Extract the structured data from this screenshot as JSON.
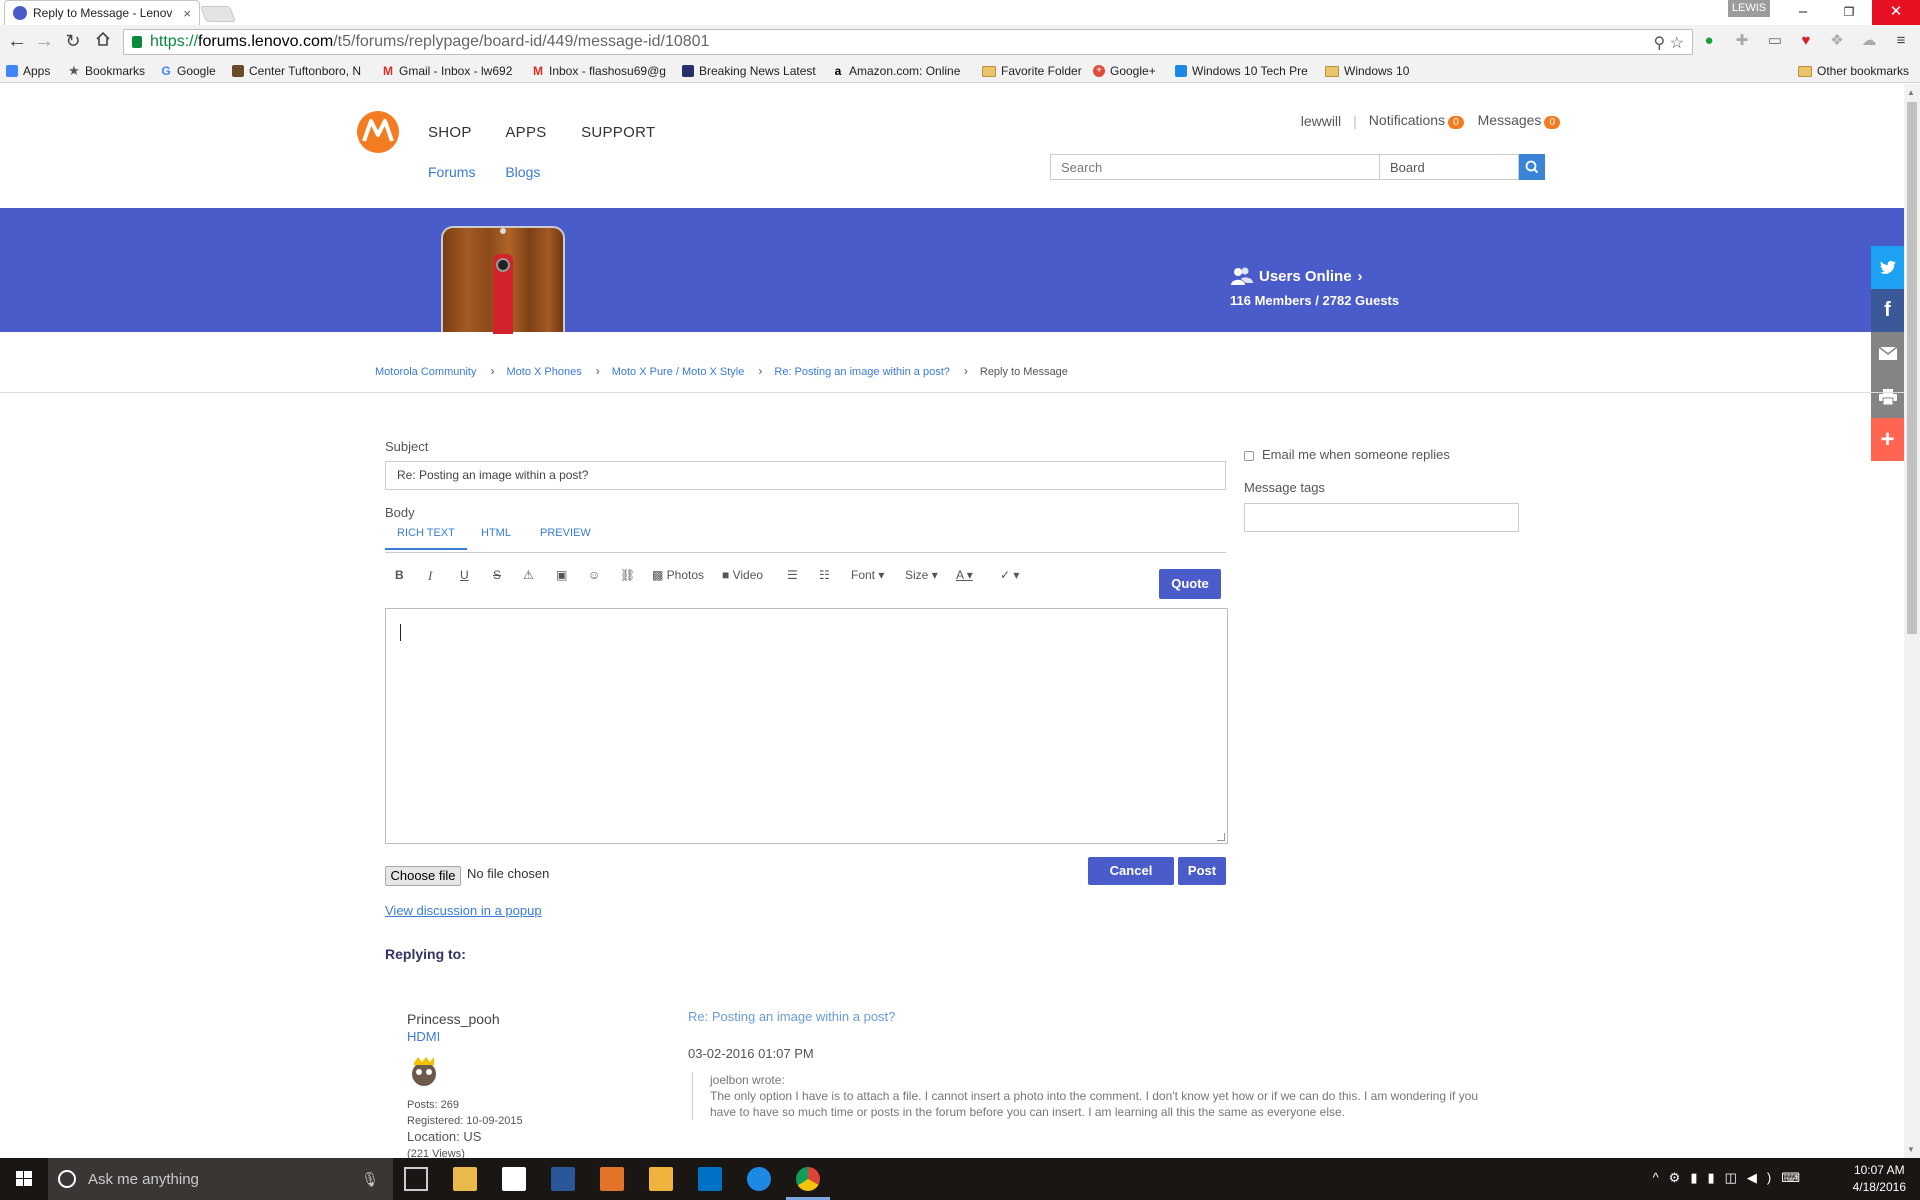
{
  "browser": {
    "tab_title": "Reply to Message - Lenov",
    "tab_close": "×",
    "profile": "LEWIS",
    "url_scheme": "https://",
    "url_host": "forums.lenovo.com",
    "url_path": "/t5/forums/replypage/board-id/449/message-id/10801",
    "window_controls": [
      "–",
      "❐",
      "✕"
    ]
  },
  "bookmarks": [
    {
      "label": "Apps",
      "icon": "apps-grid-icon"
    },
    {
      "label": "Bookmarks",
      "icon": "star-icon"
    },
    {
      "label": "Google",
      "icon": "google-icon"
    },
    {
      "label": "Center Tuftonboro, N",
      "icon": "site-icon"
    },
    {
      "label": "Gmail - Inbox - lw692",
      "icon": "gmail-icon"
    },
    {
      "label": "Inbox - flashosu69@g",
      "icon": "gmail-icon"
    },
    {
      "label": "Breaking News Latest",
      "icon": "news-icon"
    },
    {
      "label": "Amazon.com: Online",
      "icon": "amazon-icon"
    },
    {
      "label": "Favorite Folder",
      "icon": "folder-icon"
    },
    {
      "label": "Google+",
      "icon": "google-plus-icon"
    },
    {
      "label": "Windows 10 Tech Pre",
      "icon": "windows-icon"
    },
    {
      "label": "Windows 10",
      "icon": "folder-icon"
    }
  ],
  "other_bookmarks": "Other bookmarks",
  "header": {
    "nav": [
      "SHOP",
      "APPS",
      "SUPPORT"
    ],
    "subnav": [
      "Forums",
      "Blogs"
    ],
    "username": "lewwill",
    "notifications_label": "Notifications",
    "notifications_count": "0",
    "messages_label": "Messages",
    "messages_count": "0",
    "search_placeholder": "Search",
    "search_scope": "Board"
  },
  "banner": {
    "users_online": "Users Online",
    "users_online_chevron": "›",
    "stats": "116 Members / 2782 Guests"
  },
  "breadcrumb": [
    "Motorola Community",
    "Moto X Phones",
    "Moto X Pure / Moto X Style",
    "Re: Posting an image within a post?",
    "Reply to Message"
  ],
  "form": {
    "subject_label": "Subject",
    "subject_value": "Re: Posting an image within a post?",
    "body_label": "Body",
    "tabs": [
      "RICH TEXT",
      "HTML",
      "PREVIEW"
    ],
    "toolbar": {
      "bold": "B",
      "italic": "I",
      "underline": "U",
      "strike": "S",
      "photos": "Photos",
      "video": "Video",
      "font": "Font",
      "size": "Size",
      "color": "A"
    },
    "quote_button": "Quote",
    "choose_file": "Choose file",
    "no_file": "No file chosen",
    "cancel_button": "Cancel",
    "post_button": "Post",
    "popup_link": "View discussion in a popup",
    "replying_to": "Replying to:",
    "email_me": "Email me when someone replies",
    "tags_label": "Message tags"
  },
  "post": {
    "author": "Princess_pooh",
    "rank": "HDMI",
    "posts": "Posts: 269",
    "registered": "Registered: 10-09-2015",
    "location": "Location: US",
    "views": "(221 Views)",
    "title": "Re: Posting an image within a post?",
    "date": "03-02-2016 01:07 PM",
    "quote_author": "joelbon wrote:",
    "quote_text": "The only option I have is to attach a file. I cannot insert a photo into the comment. I don't know yet how or if we can do this. I am wondering if you have to have so much time or posts in the forum before you can insert. I am learning all this the same as everyone else."
  },
  "taskbar": {
    "search_placeholder": "Ask me anything",
    "time": "10:07 AM",
    "date": "4/18/2016"
  },
  "colors": {
    "brand_orange": "#f47c20",
    "banner_blue": "#4a5cc9",
    "link_blue": "#3a7bd5"
  }
}
